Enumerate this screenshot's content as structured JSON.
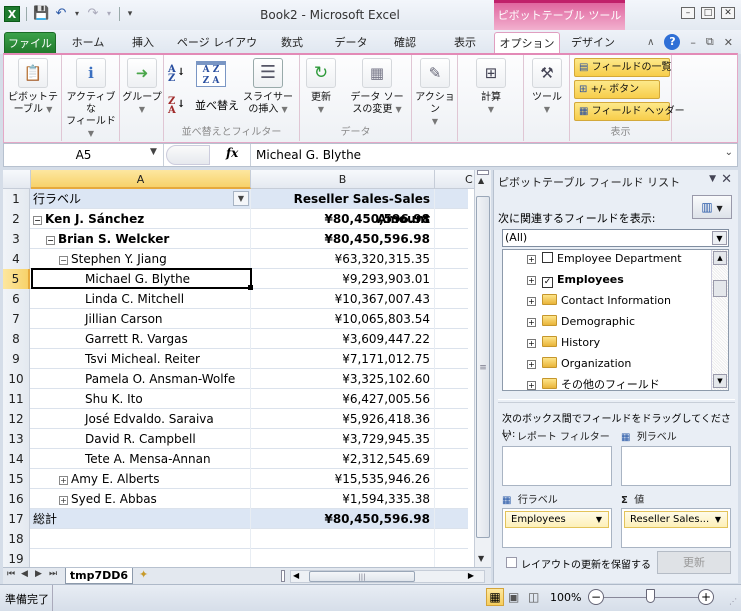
{
  "window": {
    "title": "Book2 - Microsoft Excel",
    "context_tab_group": "ピボットテーブル ツール"
  },
  "qat": {
    "save_icon": "save-icon",
    "undo_icon": "undo-icon",
    "redo_icon": "redo-icon"
  },
  "tabs": [
    {
      "label": "ファイル",
      "active": false
    },
    {
      "label": "ホーム",
      "active": false
    },
    {
      "label": "挿入",
      "active": false
    },
    {
      "label": "ページ レイアウト",
      "active": false
    },
    {
      "label": "数式",
      "active": false
    },
    {
      "label": "データ",
      "active": false
    },
    {
      "label": "確認",
      "active": false
    },
    {
      "label": "表示",
      "active": false
    },
    {
      "label": "オプション",
      "active": true
    },
    {
      "label": "デザイン",
      "active": false
    }
  ],
  "ribbon": {
    "pivottable": {
      "line1": "ピボットテ",
      "line2": "ーブル"
    },
    "active_field": {
      "line1": "アクティブな",
      "line2": "フィールド"
    },
    "group": {
      "line1": "グループ"
    },
    "sort_label": "並べ替え",
    "slicer": {
      "line1": "スライサー",
      "line2": "の挿入"
    },
    "sort_filter_group": "並べ替えとフィルター",
    "refresh": {
      "line1": "更新"
    },
    "change_source": {
      "line1": "データ ソー",
      "line2": "スの変更"
    },
    "data_group": "データ",
    "actions": {
      "line1": "アクション"
    },
    "calculations": {
      "line1": "計算"
    },
    "tools": {
      "line1": "ツール"
    },
    "field_list": "フィールドの一覧",
    "plus_minus": "+/- ボタン",
    "field_headers": "フィールド ヘッダー",
    "show_group": "表示"
  },
  "formula_bar": {
    "name_box": "A5",
    "fx": "fx",
    "formula": "Micheal G. Blythe"
  },
  "columns": [
    "A",
    "B",
    "C"
  ],
  "rows": [
    {
      "num": "1",
      "a": "行ラベル",
      "b": "Reseller Sales-Sales Amount",
      "type": "header"
    },
    {
      "num": "2",
      "a": "Ken J. Sánchez",
      "b": "¥80,450,596.98",
      "type": "bold",
      "indent": 0,
      "toggle": "minus"
    },
    {
      "num": "3",
      "a": "Brian S. Welcker",
      "b": "¥80,450,596.98",
      "type": "bold",
      "indent": 1,
      "toggle": "minus"
    },
    {
      "num": "4",
      "a": "Stephen Y. Jiang",
      "b": "¥63,320,315.35",
      "type": "normal",
      "indent": 2,
      "toggle": "minus"
    },
    {
      "num": "5",
      "a": "Michael G. Blythe",
      "b": "¥9,293,903.01",
      "type": "normal",
      "indent": 3
    },
    {
      "num": "6",
      "a": "Linda C. Mitchell",
      "b": "¥10,367,007.43",
      "type": "normal",
      "indent": 3
    },
    {
      "num": "7",
      "a": "Jillian Carson",
      "b": "¥10,065,803.54",
      "type": "normal",
      "indent": 3
    },
    {
      "num": "8",
      "a": "Garrett R. Vargas",
      "b": "¥3,609,447.22",
      "type": "normal",
      "indent": 3
    },
    {
      "num": "9",
      "a": "Tsvi Micheal. Reiter",
      "b": "¥7,171,012.75",
      "type": "normal",
      "indent": 3
    },
    {
      "num": "10",
      "a": "Pamela O. Ansman-Wolfe",
      "b": "¥3,325,102.60",
      "type": "normal",
      "indent": 3
    },
    {
      "num": "11",
      "a": "Shu K. Ito",
      "b": "¥6,427,005.56",
      "type": "normal",
      "indent": 3
    },
    {
      "num": "12",
      "a": "José Edvaldo. Saraiva",
      "b": "¥5,926,418.36",
      "type": "normal",
      "indent": 3
    },
    {
      "num": "13",
      "a": "David R. Campbell",
      "b": "¥3,729,945.35",
      "type": "normal",
      "indent": 3
    },
    {
      "num": "14",
      "a": "Tete A. Mensa-Annan",
      "b": "¥2,312,545.69",
      "type": "normal",
      "indent": 3
    },
    {
      "num": "15",
      "a": "Amy E. Alberts",
      "b": "¥15,535,946.26",
      "type": "normal",
      "indent": 2,
      "toggle": "plus"
    },
    {
      "num": "16",
      "a": "Syed E. Abbas",
      "b": "¥1,594,335.38",
      "type": "normal",
      "indent": 2,
      "toggle": "plus"
    },
    {
      "num": "17",
      "a": "総計",
      "b": "¥80,450,596.98",
      "type": "total"
    },
    {
      "num": "18",
      "a": "",
      "b": "",
      "type": "empty"
    },
    {
      "num": "19",
      "a": "",
      "b": "",
      "type": "empty"
    }
  ],
  "selected_cell": "A5",
  "sheet_tab": "tmp7DD6",
  "status": {
    "text": "準備完了",
    "zoom": "100%"
  },
  "field_list": {
    "title": "ピボットテーブル フィールド リスト",
    "show_related_label": "次に関連するフィールドを表示:",
    "filter_value": "(All)",
    "fields": [
      {
        "label": "Employee Department",
        "kind": "checkbox",
        "checked": false
      },
      {
        "label": "Employees",
        "kind": "checkbox",
        "checked": true
      },
      {
        "label": "Contact Information",
        "kind": "folder"
      },
      {
        "label": "Demographic",
        "kind": "folder"
      },
      {
        "label": "History",
        "kind": "folder"
      },
      {
        "label": "Organization",
        "kind": "folder"
      },
      {
        "label": "その他のフィールド",
        "kind": "folder"
      }
    ],
    "drag_label": "次のボックス間でフィールドをドラッグしてください:",
    "report_filter": "レポート フィルター",
    "column_labels": "列ラベル",
    "row_labels": "行ラベル",
    "values": "値",
    "row_chip": "Employees",
    "value_chip": "Reseller Sales...",
    "defer_label": "レイアウトの更新を保留する",
    "update_button": "更新"
  }
}
